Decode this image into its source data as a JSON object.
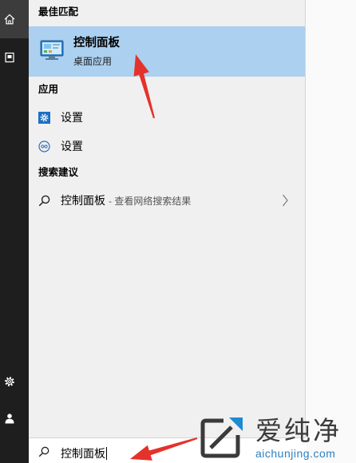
{
  "colors": {
    "sidebar": "#1e1e1e",
    "sidebar_selected": "#3c3c3c",
    "panel": "#f0f0f0",
    "highlight": "#acd0ef",
    "accent": "#1d6fc4",
    "annotation": "#e4322b",
    "watermark_url": "#2d7fc0"
  },
  "sidebar": {
    "items": [
      {
        "icon": "home-icon",
        "selected": true
      },
      {
        "icon": "documents-icon",
        "selected": false
      },
      {
        "icon": "gear-icon",
        "selected": false
      },
      {
        "icon": "user-icon",
        "selected": false
      }
    ]
  },
  "results": {
    "best_match": {
      "header": "最佳匹配",
      "title": "控制面板",
      "subtitle": "桌面应用",
      "icon": "control-panel-icon"
    },
    "apps": {
      "header": "应用",
      "items": [
        {
          "label": "设置",
          "icon": "settings-gear-tile-icon"
        },
        {
          "label": "设置",
          "icon": "settings-circle-icon"
        }
      ]
    },
    "suggestions": {
      "header": "搜索建议",
      "items": [
        {
          "query": "控制面板",
          "hint": "- 查看网络搜索结果",
          "icon": "search-icon",
          "trailing_icon": "chevron-right-icon"
        }
      ]
    }
  },
  "search_box": {
    "value": "控制面板",
    "icon": "search-icon"
  },
  "watermark": {
    "brand": "爱纯净",
    "url": "aichunjing.com",
    "logo_icon": "aichunjing-logo-icon"
  }
}
